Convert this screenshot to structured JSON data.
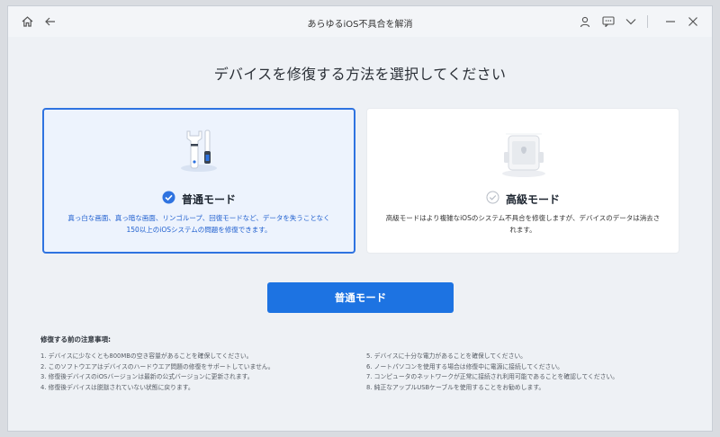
{
  "window": {
    "title": "あらゆるiOS不具合を解消"
  },
  "heading": "デバイスを修復する方法を選択してください",
  "cards": {
    "standard": {
      "label": "普通モード",
      "description": "真っ白な画面、真っ暗な画面、リンゴループ、回復モードなど、データを失うことなく150以上のiOSシステムの問題を修復できます。",
      "selected": true
    },
    "advanced": {
      "label": "高級モード",
      "description": "高級モードはより複雑なiOSのシステム不具合を修復しますが、デバイスのデータは消去されます。",
      "selected": false
    }
  },
  "primary_button": "普通モード",
  "notes": {
    "title": "修復する前の注意事項:",
    "items": [
      "1. デバイスに少なくとも800MBの空き容量があることを確保してください。",
      "2. このソフトウエアはデバイスのハードウエア問題の修復をサポートしていません。",
      "3. 修復後デバイスのiOSバージョンは最新の公式バージョンに更新されます。",
      "4. 修復後デバイスは脱獄されていない状態に戻ります。",
      "5. デバイスに十分な電力があることを確保してください。",
      "6. ノートパソコンを使用する場合は修復中に電源に接続してください。",
      "7. コンピュータのネットワークが正常に接続され利用可能であることを確認してください。",
      "8. 純正なアップルUSBケーブルを使用することをお勧めします。"
    ]
  },
  "colors": {
    "accent": "#1d73e2",
    "selected_border": "#2f73e0",
    "selected_bg": "#edf3fd"
  },
  "icons": {
    "home": "home-icon",
    "back": "back-arrow-icon",
    "account": "user-icon",
    "feedback": "message-icon",
    "menu": "chevron-down-icon",
    "minimize": "minimize-icon",
    "close": "close-icon",
    "standard_mode": "repair-tools-icon",
    "advanced_mode": "phone-icon",
    "check": "check-circle-icon"
  }
}
